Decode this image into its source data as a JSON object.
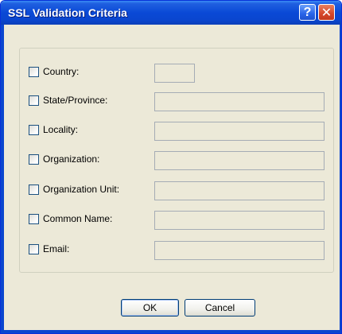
{
  "window": {
    "title": "SSL Validation Criteria",
    "help_icon": "help-icon",
    "help_glyph": "?",
    "close_icon": "close-icon",
    "close_glyph": "✕"
  },
  "criteria": [
    {
      "label": "Country:",
      "checked": false,
      "value": ""
    },
    {
      "label": "State/Province:",
      "checked": false,
      "value": ""
    },
    {
      "label": "Locality:",
      "checked": false,
      "value": ""
    },
    {
      "label": "Organization:",
      "checked": false,
      "value": ""
    },
    {
      "label": "Organization Unit:",
      "checked": false,
      "value": ""
    },
    {
      "label": "Common Name:",
      "checked": false,
      "value": ""
    },
    {
      "label": "Email:",
      "checked": false,
      "value": ""
    }
  ],
  "buttons": {
    "ok": "OK",
    "cancel": "Cancel"
  },
  "colors": {
    "titlebar": "#0a46cf",
    "dialog_bg": "#ece9d8",
    "close_button": "#d5462a"
  }
}
